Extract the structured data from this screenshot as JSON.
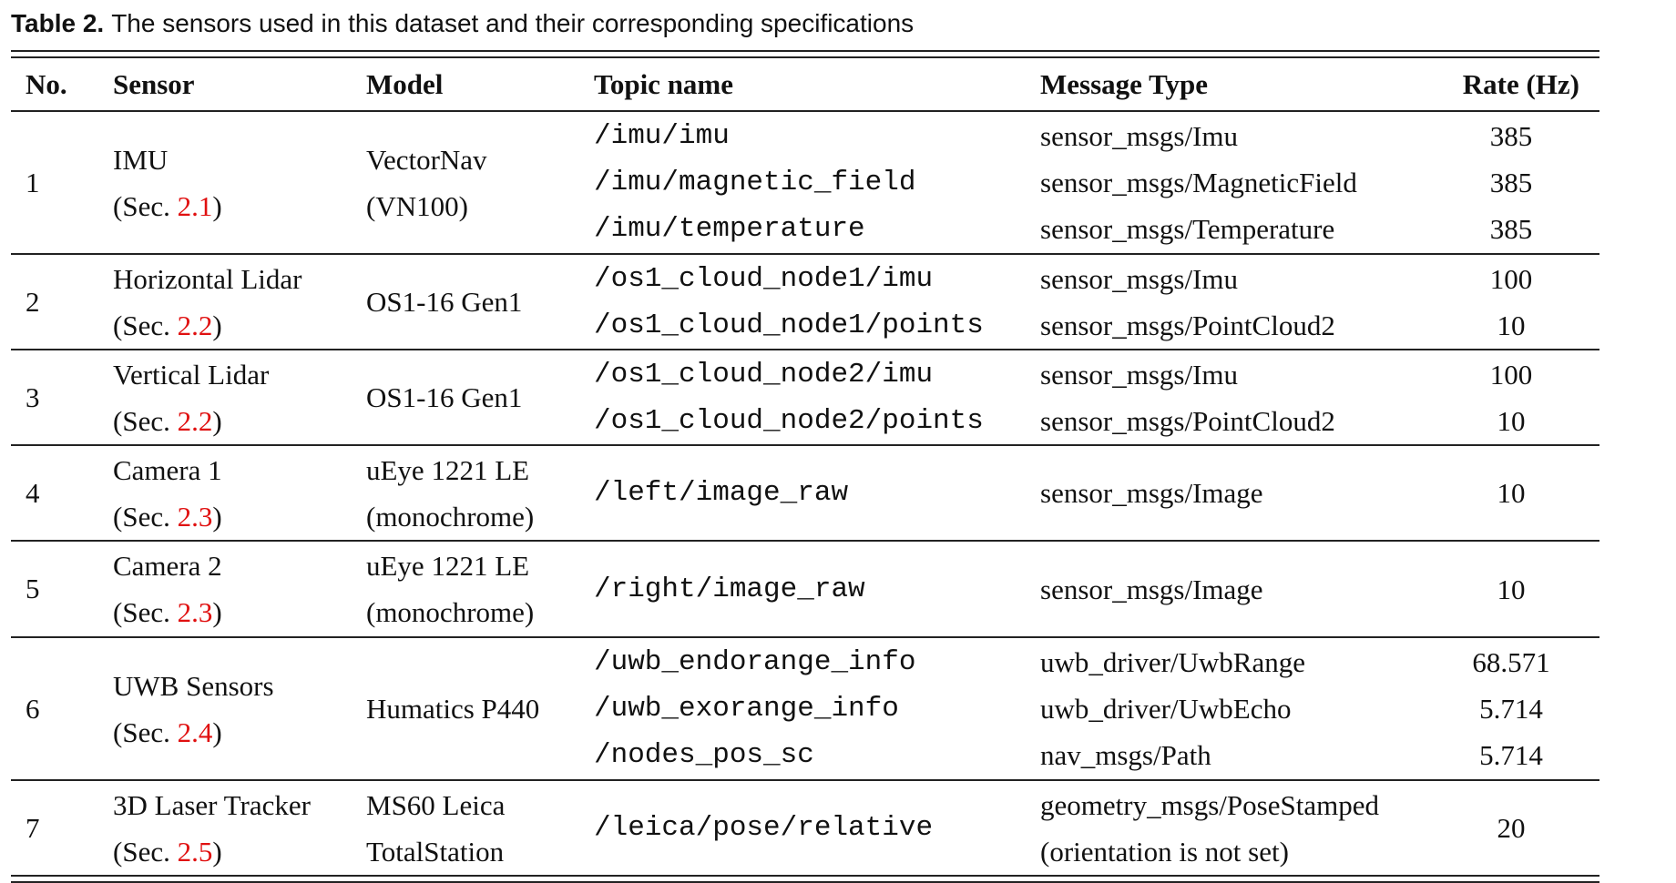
{
  "caption": {
    "label": "Table 2.",
    "text": "The sensors used in this dataset and their corresponding specifications"
  },
  "headers": {
    "no": "No.",
    "sensor": "Sensor",
    "model": "Model",
    "topic": "Topic name",
    "message": "Message Type",
    "rate": "Rate (Hz)"
  },
  "rows": [
    {
      "no": "1",
      "sensor": "IMU",
      "sec_prefix": "(Sec. ",
      "sec_ref": "2.1",
      "sec_suffix": ")",
      "model": [
        "VectorNav",
        "(VN100)"
      ],
      "topics": [
        "/imu/imu",
        "/imu/magnetic_field",
        "/imu/temperature"
      ],
      "messages": [
        "sensor_msgs/Imu",
        "sensor_msgs/MagneticField",
        "sensor_msgs/Temperature"
      ],
      "rates": [
        "385",
        "385",
        "385"
      ]
    },
    {
      "no": "2",
      "sensor": "Horizontal Lidar",
      "sec_prefix": "(Sec. ",
      "sec_ref": "2.2",
      "sec_suffix": ")",
      "model": [
        "OS1-16 Gen1"
      ],
      "topics": [
        "/os1_cloud_node1/imu",
        "/os1_cloud_node1/points"
      ],
      "messages": [
        "sensor_msgs/Imu",
        "sensor_msgs/PointCloud2"
      ],
      "rates": [
        "100",
        "10"
      ]
    },
    {
      "no": "3",
      "sensor": "Vertical Lidar",
      "sec_prefix": "(Sec. ",
      "sec_ref": "2.2",
      "sec_suffix": ")",
      "model": [
        "OS1-16 Gen1"
      ],
      "topics": [
        "/os1_cloud_node2/imu",
        "/os1_cloud_node2/points"
      ],
      "messages": [
        "sensor_msgs/Imu",
        "sensor_msgs/PointCloud2"
      ],
      "rates": [
        "100",
        "10"
      ]
    },
    {
      "no": "4",
      "sensor": "Camera 1",
      "sec_prefix": "(Sec. ",
      "sec_ref": "2.3",
      "sec_suffix": ")",
      "model": [
        "uEye 1221 LE",
        "(monochrome)"
      ],
      "topics": [
        "/left/image_raw"
      ],
      "messages": [
        "sensor_msgs/Image"
      ],
      "rates": [
        "10"
      ]
    },
    {
      "no": "5",
      "sensor": "Camera 2",
      "sec_prefix": "(Sec. ",
      "sec_ref": "2.3",
      "sec_suffix": ")",
      "model": [
        "uEye 1221 LE",
        "(monochrome)"
      ],
      "topics": [
        "/right/image_raw"
      ],
      "messages": [
        "sensor_msgs/Image"
      ],
      "rates": [
        "10"
      ]
    },
    {
      "no": "6",
      "sensor": "UWB Sensors",
      "sec_prefix": "(Sec. ",
      "sec_ref": "2.4",
      "sec_suffix": ")",
      "model": [
        "Humatics P440"
      ],
      "topics": [
        "/uwb_endorange_info",
        "/uwb_exorange_info",
        "/nodes_pos_sc"
      ],
      "messages": [
        "uwb_driver/UwbRange",
        "uwb_driver/UwbEcho",
        "nav_msgs/Path"
      ],
      "rates": [
        "68.571",
        "5.714",
        "5.714"
      ]
    },
    {
      "no": "7",
      "sensor": "3D Laser Tracker",
      "sec_prefix": "(Sec. ",
      "sec_ref": "2.5",
      "sec_suffix": ")",
      "model": [
        "MS60 Leica",
        "TotalStation"
      ],
      "topics": [
        "/leica/pose/relative"
      ],
      "messages": [
        "geometry_msgs/PoseStamped",
        "(orientation is not set)"
      ],
      "rates": [
        "20"
      ]
    }
  ],
  "colors": {
    "reference_link": "#e01010",
    "text": "#111111",
    "rule": "#222222"
  }
}
